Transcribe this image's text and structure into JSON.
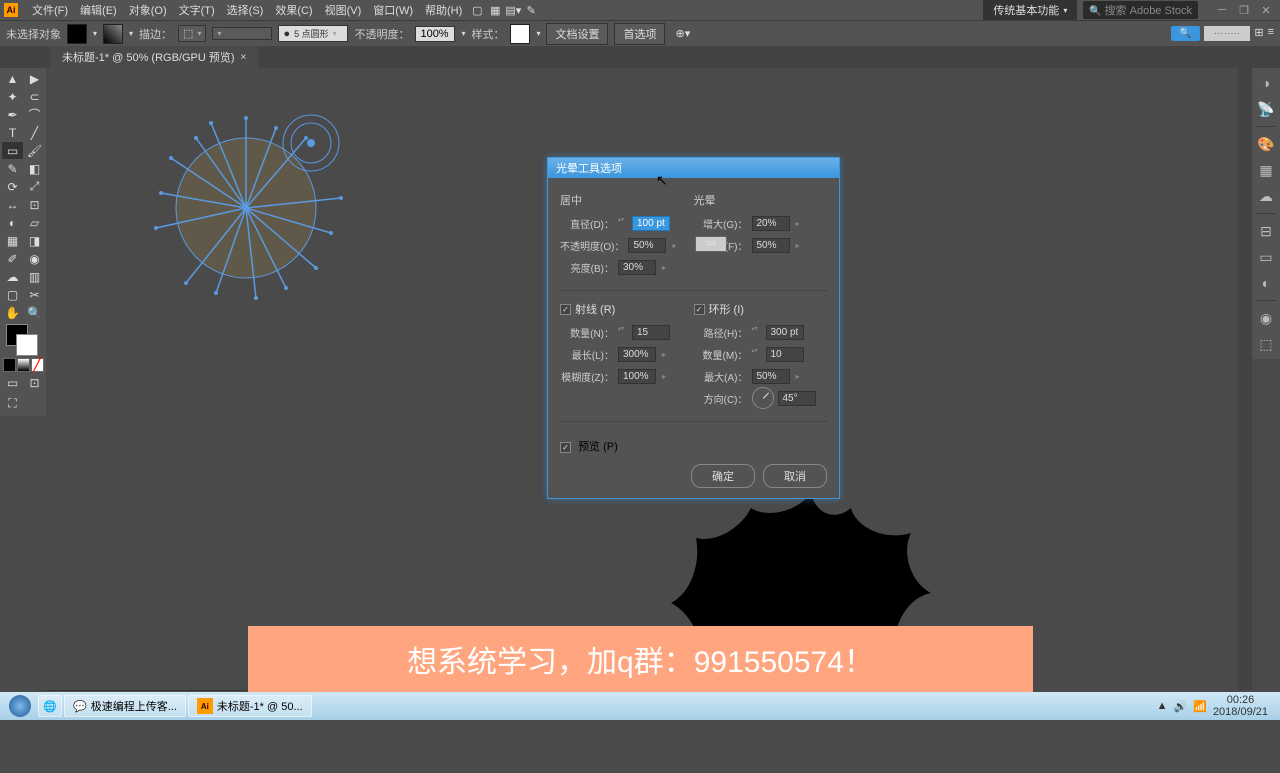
{
  "menubar": {
    "items": [
      "文件(F)",
      "编辑(E)",
      "对象(O)",
      "文字(T)",
      "选择(S)",
      "效果(C)",
      "视图(V)",
      "窗口(W)",
      "帮助(H)"
    ],
    "workspace": "传统基本功能",
    "search": "搜索 Adobe Stock"
  },
  "ctrlbar": {
    "no_selection": "未选择对象",
    "stroke": "描边：",
    "stroke_style": "5 点圆形",
    "opacity_label": "不透明度：",
    "opacity": "100%",
    "style": "样式：",
    "doc_setup": "文档设置",
    "prefs": "首选项"
  },
  "tab": {
    "title": "未标题-1* @ 50% (RGB/GPU 预览)"
  },
  "dialog": {
    "title": "光晕工具选项",
    "center": {
      "title": "居中",
      "diameter_label": "直径(D)：",
      "diameter": "100 pt",
      "opacity_label": "不透明度(O)：",
      "opacity": "50%",
      "brightness_label": "亮度(B)：",
      "brightness": "30%"
    },
    "halo": {
      "title": "光晕",
      "growth_label": "增大(G)：",
      "growth": "20%",
      "fuzz_label": "模糊度(F)：",
      "fuzz": "50%"
    },
    "rays": {
      "title": "射线 (R)",
      "count_label": "数量(N)：",
      "count": "15",
      "longest_label": "最长(L)：",
      "longest": "300%",
      "fuzz_label": "模糊度(Z)：",
      "fuzz": "100%"
    },
    "rings": {
      "title": "环形 (I)",
      "path_label": "路径(H)：",
      "path": "300 pt",
      "count_label": "数量(M)：",
      "count": "10",
      "largest_label": "最大(A)：",
      "largest": "50%",
      "direction_label": "方向(C)：",
      "direction": "45°"
    },
    "preview": "预览 (P)",
    "ok": "确定",
    "cancel": "取消"
  },
  "zoom": "50%",
  "banner": "想系统学习，加q群：991550574！",
  "taskbar": {
    "items": [
      "极速编程上传客...",
      "未标题-1* @ 50..."
    ],
    "time": "00:26",
    "date": "2018/09/21"
  }
}
